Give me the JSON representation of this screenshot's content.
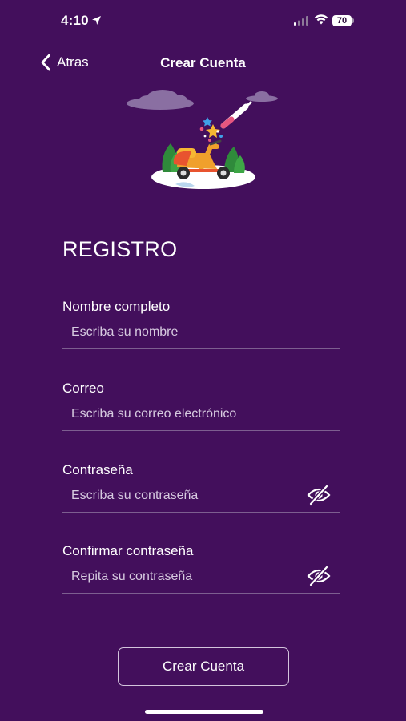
{
  "status_bar": {
    "time": "4:10",
    "battery": "70",
    "icons": [
      "location-arrow-icon",
      "signal-icon",
      "wifi-icon",
      "battery-icon"
    ]
  },
  "nav": {
    "back_label": "Atras",
    "title": "Crear Cuenta"
  },
  "illustration": {
    "icon": "scooter-illustration"
  },
  "form": {
    "title": "REGISTRO",
    "fields": [
      {
        "label": "Nombre completo",
        "placeholder": "Escriba su nombre",
        "value": ""
      },
      {
        "label": "Correo",
        "placeholder": "Escriba su correo electrónico",
        "value": ""
      },
      {
        "label": "Contraseña",
        "placeholder": "Escriba su contraseña",
        "value": "",
        "icon": "eye-slash-icon"
      },
      {
        "label": "Confirmar contraseña",
        "placeholder": "Repita su contraseña",
        "value": "",
        "icon": "eye-slash-icon"
      }
    ],
    "submit_label": "Crear Cuenta"
  },
  "colors": {
    "background": "#430f5c",
    "text": "#ffffff",
    "placeholder": "#d7cbe0",
    "divider": "#7d5e90",
    "button_border": "#d3c4dc"
  }
}
